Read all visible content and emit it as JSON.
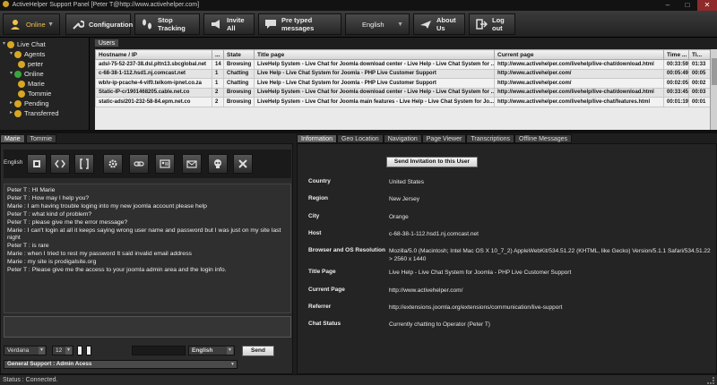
{
  "window": {
    "title": "ActiveHelper Support Panel [Peter T@http://www.activehelper.com]"
  },
  "toolbar": {
    "online": "Online",
    "configuration": "Configuration",
    "stop_tracking": "Stop Tracking",
    "invite_all": "Invite All",
    "pretyped": "Pre typed messages",
    "language": "English",
    "about": "About Us",
    "logout": "Log out"
  },
  "tree": {
    "live_chat": "Live Chat",
    "agents": "Agents",
    "agent_peter": "peter",
    "online": "Online",
    "online_marie": "Marie",
    "online_tommie": "Tommie",
    "pending": "Pending",
    "transferred": "Transferred"
  },
  "users": {
    "tab": "Users",
    "columns": [
      "Hostname / IP",
      "...",
      "State",
      "Title page",
      "Current page",
      "Time ...",
      "Ti..."
    ],
    "rows": [
      [
        "adsl-75-52-237-38.dsl.pltn13.sbcglobal.net",
        "14",
        "Browsing",
        "LiveHelp System - Live Chat for Joomla download center - Live Help - Live Chat System for ...",
        "http://www.activehelper.com/livehelp/live-chat/download.html",
        "00:33:59",
        "01:33"
      ],
      [
        "c-68-38-1-112.hsd1.nj.comcast.net",
        "1",
        "Chatting",
        "Live Help - Live Chat System for Joomla - PHP Live Customer Support",
        "http://www.activehelper.com/",
        "00:05:49",
        "00:05"
      ],
      [
        "wblv-ip-pcache-4-vif0.telkom-ipnet.co.za",
        "1",
        "Chatting",
        "Live Help - Live Chat System for Joomla - PHP Live Customer Support",
        "http://www.activehelper.com/",
        "00:02:05",
        "00:02"
      ],
      [
        "Static-IP-cr1901468205.cable.net.co",
        "2",
        "Browsing",
        "LiveHelp System - Live Chat for Joomla download center - Live Help - Live Chat System for ...",
        "http://www.activehelper.com/livehelp/live-chat/download.html",
        "00:33:45",
        "00:03"
      ],
      [
        "static-adsl201-232-58-84.epm.net.co",
        "2",
        "Browsing",
        "LiveHelp System - Live Chat for Joomla main features - Live Help - Live Chat System for Jo...",
        "http://www.activehelper.com/livehelp/live-chat/features.html",
        "00:01:19",
        "00:01"
      ]
    ]
  },
  "chat": {
    "tabs": [
      "Marie",
      "Tommie"
    ],
    "language_label": "English",
    "format_icons": [
      "bold-icon",
      "code-icon",
      "brackets-icon",
      "gear-icon",
      "link-icon",
      "card-icon",
      "mail-icon",
      "skull-icon",
      "close-icon"
    ],
    "messages": [
      "Peter T : HI Marie",
      "Peter T : How may I help you?",
      "Marie : I am having trouble loging into my new joomla account please help",
      "Peter T : what kind of problem?",
      "Peter T : please give me the error message?",
      "Marie : I can't login at all it keeps saying wrong user name and password but I was just on my site last night",
      "Peter T : is rare",
      "Marie : when I tried to rest my password It said invalid email address",
      "Marie : my site is prodigalsite.org",
      "Peter T : Please give me the access to your joomla admin area and the login info."
    ],
    "font": "Verdana",
    "size": "12",
    "language_select": "English",
    "send": "Send",
    "department": "General Support : Admin Acess"
  },
  "info": {
    "tabs": [
      "Information",
      "Geo Location",
      "Navigation",
      "Page Viewer",
      "Transcriptions",
      "Offline Messages"
    ],
    "invite_button": "Send Invitation to this User",
    "fields": [
      {
        "label": "Country",
        "value": "United States"
      },
      {
        "label": "Region",
        "value": "New Jersey"
      },
      {
        "label": "City",
        "value": "Orange"
      },
      {
        "label": "Host",
        "value": "c-68-38-1-112.hsd1.nj.comcast.net"
      },
      {
        "label": "Browser and OS Resolution",
        "value": "Mozilla/5.0 (Macintosh; Intel Mac OS X 10_7_2) AppleWebKit/534.51.22 (KHTML, like Gecko) Version/5.1.1 Safari/534.51.22 > 2560 x 1440"
      },
      {
        "label": "Title Page",
        "value": "Live Help - Live Chat System for Joomla - PHP Live Customer Support"
      },
      {
        "label": "Current Page",
        "value": "http://www.activehelper.com/"
      },
      {
        "label": "Referrer",
        "value": "http://extensions.joomla.org/extensions/communication/live-support"
      },
      {
        "label": "Chat Status",
        "value": "Currently chatting to Operator (Peter T)"
      }
    ]
  },
  "status": {
    "text": "Status : Connected."
  },
  "colors": {
    "online_yellow": "#f2c14e",
    "agent_icon": "#d9a623",
    "online_icon": "#3ba63b",
    "close_red": "#8e2a2a"
  }
}
